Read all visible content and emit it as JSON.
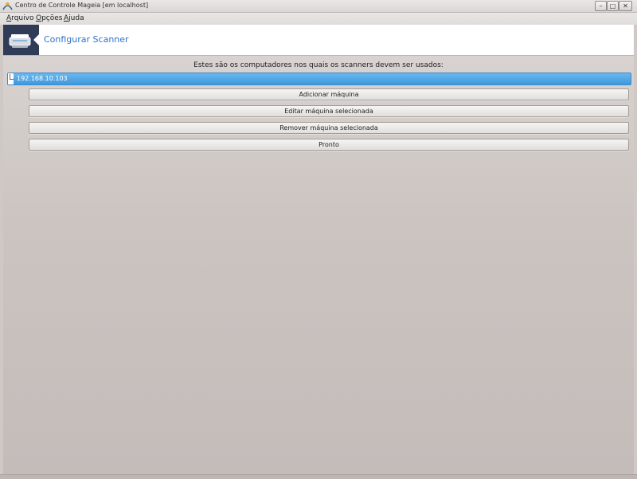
{
  "window": {
    "title": "Centro de Controle Mageia  [em localhost]",
    "minimize_glyph": "–",
    "maximize_glyph": "□",
    "close_glyph": "✕"
  },
  "menu": {
    "items": [
      {
        "label": "Arquivo"
      },
      {
        "label": "Opções"
      },
      {
        "label": "Ajuda"
      }
    ]
  },
  "banner": {
    "title": "Configurar Scanner",
    "icon": "scanner-icon",
    "icon_bg_color": "#2f3b57",
    "title_color": "#2f74c8"
  },
  "main": {
    "instruction": "Estes são os computadores nos quais os scanners devem ser usados:",
    "hosts": [
      {
        "label": "192.168.10.103",
        "selected": true
      }
    ],
    "buttons": {
      "add": "Adicionar máquina",
      "edit": "Editar máquina selecionada",
      "remove": "Remover máquina selecionada",
      "done": "Pronto"
    },
    "selection_color": "#4aa3e6"
  }
}
